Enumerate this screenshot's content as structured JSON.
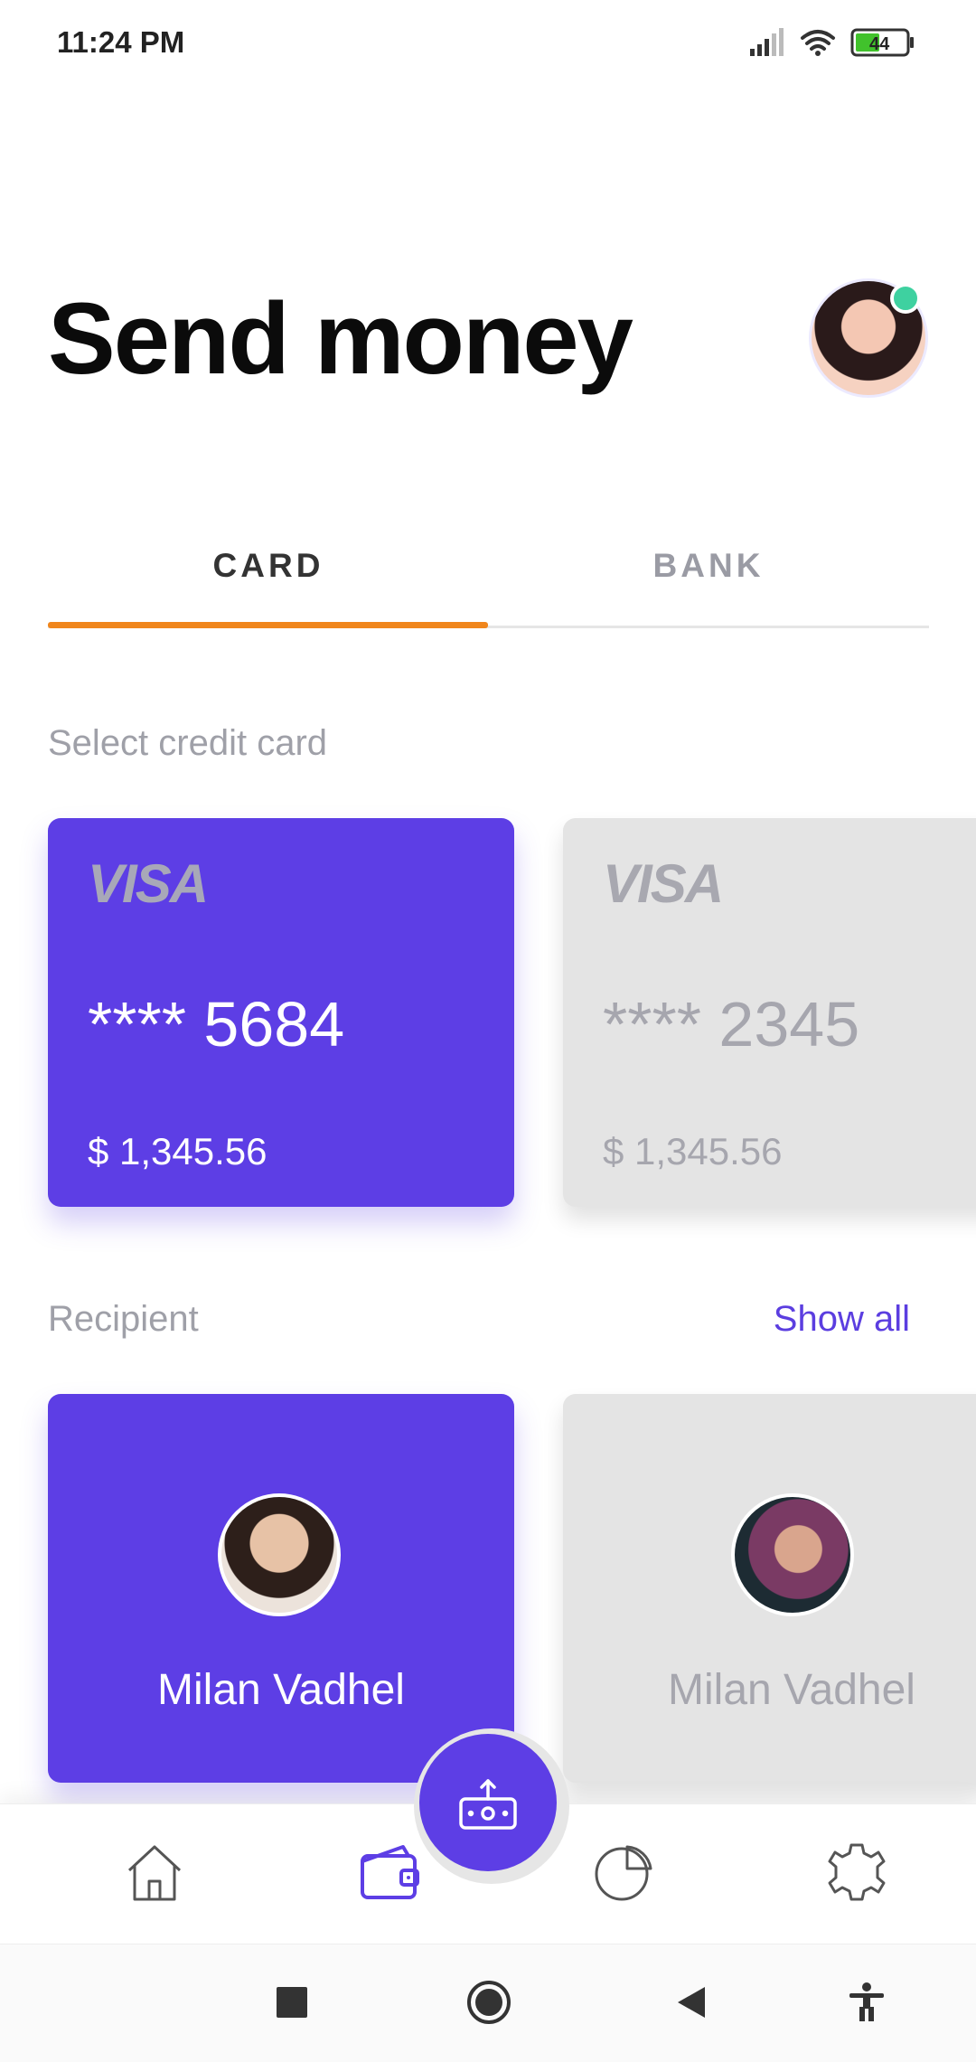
{
  "status_bar": {
    "time": "11:24 PM",
    "battery": "44",
    "icons": [
      "signal-icon",
      "wifi-icon",
      "battery-icon"
    ]
  },
  "header": {
    "title": "Send money",
    "avatar": "profile-avatar",
    "online_indicator_color": "#3ed1a0"
  },
  "tabs": [
    {
      "label": "CARD",
      "active": true
    },
    {
      "label": "BANK",
      "active": false
    }
  ],
  "cards_section": {
    "label": "Select credit card",
    "cards": [
      {
        "brand": "VISA",
        "number": "**** 5684",
        "balance": "$ 1,345.56",
        "selected": true
      },
      {
        "brand": "VISA",
        "number": "**** 2345",
        "balance": "$ 1,345.56",
        "selected": false
      }
    ]
  },
  "recipient_section": {
    "label": "Recipient",
    "show_all": "Show all",
    "recipients": [
      {
        "name": "Milan Vadhel",
        "selected": true
      },
      {
        "name": "Milan Vadhel",
        "selected": false
      }
    ]
  },
  "bottom_nav": {
    "items": [
      "home-icon",
      "wallet-icon",
      "send-money-icon",
      "stats-icon",
      "settings-icon"
    ],
    "active": "wallet-icon"
  },
  "system_nav": {
    "items": [
      "recent-apps-icon",
      "home-circle-icon",
      "back-icon",
      "accessibility-icon"
    ]
  },
  "colors": {
    "accent": "#5d3ee5",
    "tab_indicator": "#f0861c",
    "inactive_card": "#e4e4e4"
  }
}
